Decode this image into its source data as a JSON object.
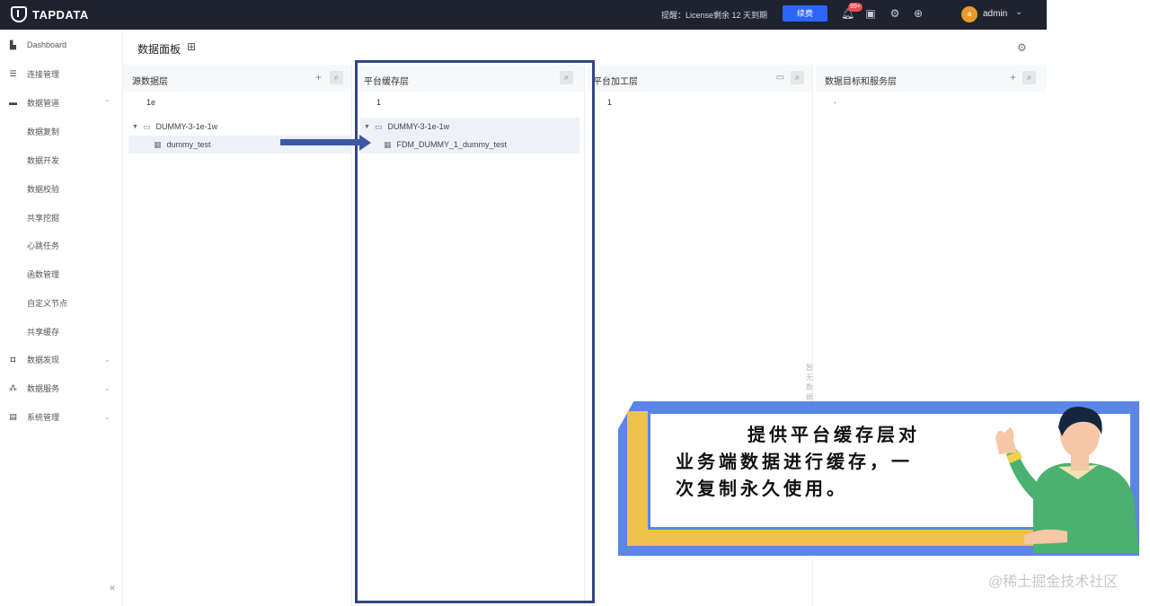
{
  "topbar": {
    "brand": "TAPDATA",
    "license_text": "提醒：License剩余 12 天到期",
    "renew_button": "续费",
    "notification_badge": "99+",
    "user_initial": "a",
    "username": "admin"
  },
  "sidebar": {
    "items": [
      {
        "label": "Dashboard",
        "icon": "dashboard-icon"
      },
      {
        "label": "连接管理",
        "icon": "connection-icon"
      },
      {
        "label": "数据管道",
        "icon": "pipeline-icon",
        "expandable": true
      },
      {
        "label": "数据复制"
      },
      {
        "label": "数据开发"
      },
      {
        "label": "数据校验"
      },
      {
        "label": "共享挖掘"
      },
      {
        "label": "心跳任务"
      },
      {
        "label": "函数管理"
      },
      {
        "label": "自定义节点"
      },
      {
        "label": "共享缓存"
      },
      {
        "label": "数据发现",
        "icon": "discovery-icon",
        "expandable": true
      },
      {
        "label": "数据服务",
        "icon": "service-icon",
        "expandable": true
      },
      {
        "label": "系统管理",
        "icon": "system-icon",
        "expandable": true
      }
    ],
    "collapse_glyph": "«"
  },
  "main": {
    "title": "数据面板",
    "columns": [
      {
        "title": "源数据层",
        "search": "1e",
        "tree": {
          "connection": "DUMMY-3-1e-1w",
          "table": "dummy_test"
        }
      },
      {
        "title": "平台缓存层",
        "search": "1",
        "tree": {
          "folder": "DUMMY-3-1e-1w",
          "table": "FDM_DUMMY_1_dummy_test"
        }
      },
      {
        "title": "平台加工层",
        "search": "1",
        "empty_text": "暂无数据"
      },
      {
        "title": "数据目标和服务层",
        "search": "·"
      }
    ]
  },
  "callout": {
    "line1": "提供平台缓存层对",
    "line2": "业务端数据进行缓存，一",
    "line3": "次复制永久使用。"
  },
  "watermark": "@稀土掘金技术社区"
}
